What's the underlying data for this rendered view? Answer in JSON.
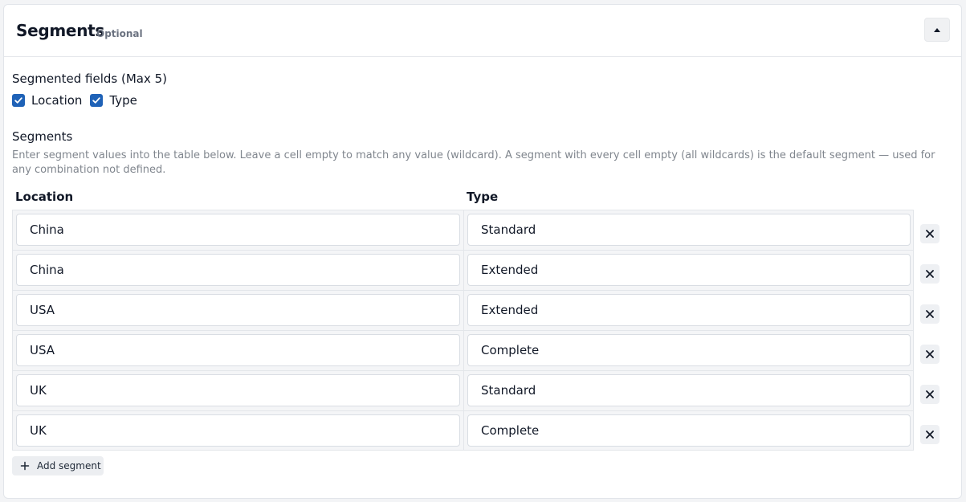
{
  "header": {
    "title": "Segments",
    "tag": "Optional",
    "collapse_icon": "caret-up-icon"
  },
  "fields": {
    "label": "Segmented fields (Max 5)",
    "options": [
      {
        "label": "Location",
        "checked": true
      },
      {
        "label": "Type",
        "checked": true
      }
    ]
  },
  "segments": {
    "label": "Segments",
    "help": "Enter segment values into the table below. Leave a cell empty to match any value (wildcard). A segment with every cell empty (all wildcards) is the default segment — used for any combination not defined.",
    "columns": [
      "Location",
      "Type"
    ],
    "rows": [
      [
        "China",
        "Standard"
      ],
      [
        "China",
        "Extended"
      ],
      [
        "USA",
        "Extended"
      ],
      [
        "USA",
        "Complete"
      ],
      [
        "UK",
        "Standard"
      ],
      [
        "UK",
        "Complete"
      ]
    ],
    "add_label": "Add segment"
  },
  "colors": {
    "accent": "#1f62b7",
    "muted": "#80868e"
  }
}
